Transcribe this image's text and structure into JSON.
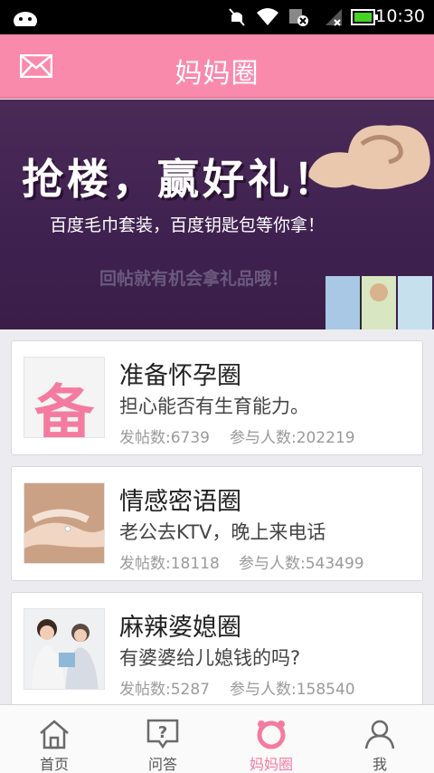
{
  "status_bar": {
    "time": "10:30"
  },
  "header": {
    "title": "妈妈圈"
  },
  "banner": {
    "headline": "抢楼，赢好礼！",
    "subtitle": "百度毛巾套装，百度钥匙包等你拿！",
    "hint": "回帖就有机会拿礼品哦！",
    "slides": 5,
    "active_slide": 1
  },
  "circles": [
    {
      "name": "准备怀孕圈",
      "desc": "担心能否有生育能力。",
      "thumb_char": "备",
      "posts_label": "发帖数:6739",
      "members_label": "参与人数:202219"
    },
    {
      "name": "情感密语圈",
      "desc": "老公去KTV，晚上来电话",
      "thumb_char": "",
      "posts_label": "发帖数:18118",
      "members_label": "参与人数:543499"
    },
    {
      "name": "麻辣婆媳圈",
      "desc": "有婆婆给儿媳钱的吗?",
      "thumb_char": "",
      "posts_label": "发帖数:5287",
      "members_label": "参与人数:158540"
    }
  ],
  "tabs": [
    {
      "label": "首页",
      "icon": "home-icon",
      "active": false
    },
    {
      "label": "问答",
      "icon": "question-icon",
      "active": false
    },
    {
      "label": "妈妈圈",
      "icon": "circle-icon",
      "active": true
    },
    {
      "label": "我",
      "icon": "profile-icon",
      "active": false
    }
  ],
  "colors": {
    "brand": "#f98aab",
    "accent": "#f47ba0",
    "banner_bg": "#4a2a57"
  }
}
